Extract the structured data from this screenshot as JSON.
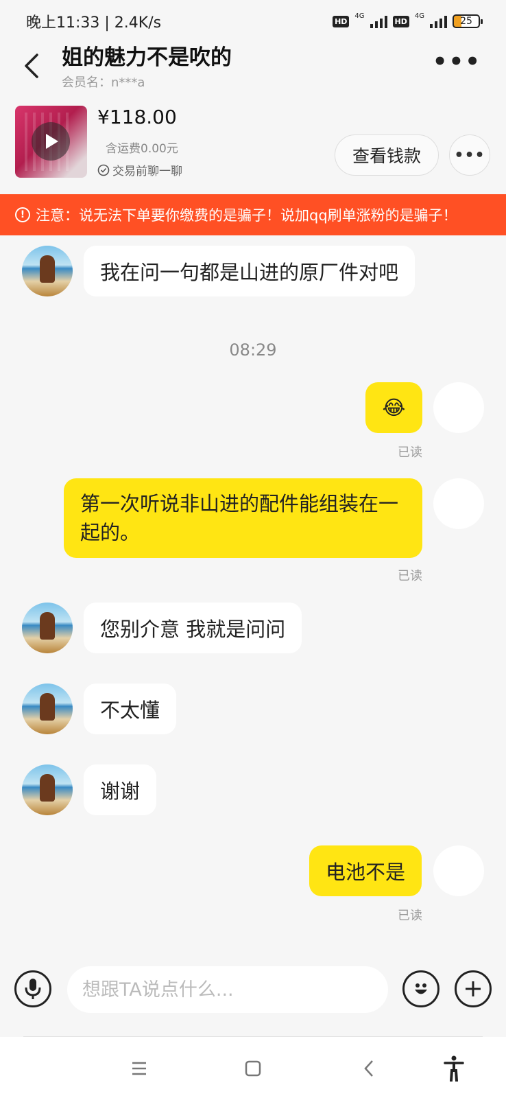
{
  "status_bar": {
    "time_speed": "晚上11:33 | 2.4K/s",
    "hd1": "HD",
    "net1": "4G",
    "hd2": "HD",
    "net2": "4G",
    "battery": "25"
  },
  "header": {
    "title": "姐的魅力不是吹的",
    "subtitle": "会员名：n***a"
  },
  "product": {
    "price": "¥118.00",
    "shipping": "含运费0.00元",
    "chat_before": "交易前聊一聊",
    "view_button": "查看钱款"
  },
  "warning": {
    "text": "注意：说无法下单要你缴费的是骗子！说加qq刷单涨粉的是骗子！"
  },
  "messages": {
    "m1": "我在问一句都是山进的原厂件对吧",
    "time": "08:29",
    "m2": "😂",
    "m2_status": "已读",
    "m3": "第一次听说非山进的配件能组装在一起的。",
    "m3_status": "已读",
    "m4": "您别介意 我就是问问",
    "m5": "不太懂",
    "m6": "谢谢",
    "m7": "电池不是",
    "m7_status": "已读"
  },
  "input": {
    "placeholder": "想跟TA说点什么..."
  },
  "icons": {
    "back": "back-arrow-icon",
    "more": "more-dots-icon",
    "play": "play-icon",
    "check": "check-circle-icon",
    "warning": "exclamation-icon",
    "mic": "microphone-icon",
    "emoji": "emoji-icon",
    "plus": "plus-icon"
  }
}
